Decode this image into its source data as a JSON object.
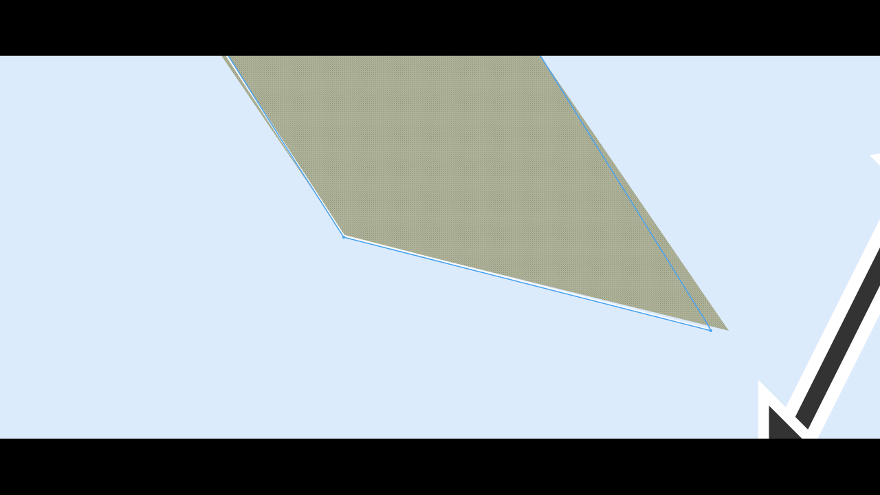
{
  "editor": {
    "mode": "edit-polygon",
    "background_color": "#dcebfc",
    "polygon": {
      "fill_color": "#a9ad92",
      "hatch_color": "#8f9479",
      "outline_color": "#4aa3f0"
    },
    "confirm": {
      "icon": "check-icon",
      "color": "#7fc98a"
    },
    "cancel": {
      "icon": "x-icon",
      "color": "#e07a8c"
    },
    "cursor": {
      "icon": "resize-diagonal-cursor-icon"
    }
  }
}
